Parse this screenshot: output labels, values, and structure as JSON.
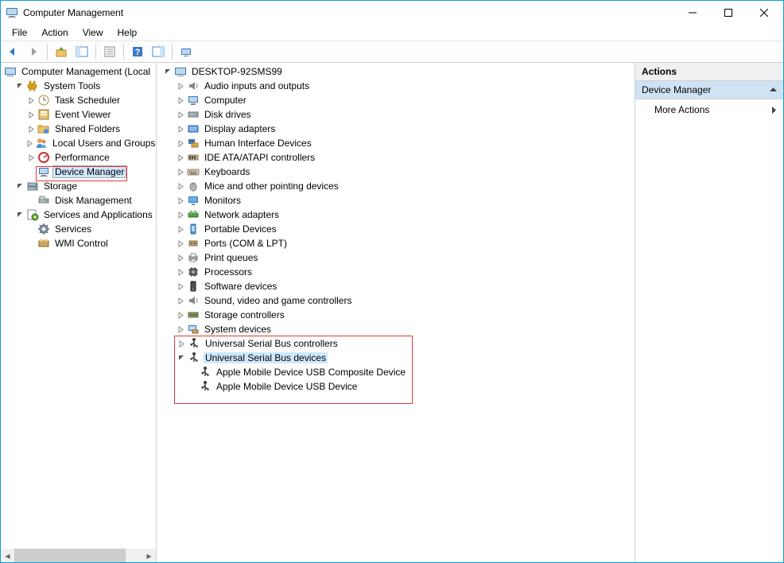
{
  "window": {
    "title": "Computer Management"
  },
  "menu": {
    "file": "File",
    "action": "Action",
    "view": "View",
    "help": "Help"
  },
  "leftTree": {
    "root": "Computer Management (Local",
    "systemTools": "System Tools",
    "taskScheduler": "Task Scheduler",
    "eventViewer": "Event Viewer",
    "sharedFolders": "Shared Folders",
    "localUsers": "Local Users and Groups",
    "performance": "Performance",
    "deviceManager": "Device Manager",
    "storage": "Storage",
    "diskManagement": "Disk Management",
    "servicesApps": "Services and Applications",
    "services": "Services",
    "wmiControl": "WMI Control"
  },
  "midTree": {
    "root": "DESKTOP-92SMS99",
    "audio": "Audio inputs and outputs",
    "computer": "Computer",
    "disk": "Disk drives",
    "display": "Display adapters",
    "hid": "Human Interface Devices",
    "ide": "IDE ATA/ATAPI controllers",
    "keyboards": "Keyboards",
    "mice": "Mice and other pointing devices",
    "monitors": "Monitors",
    "network": "Network adapters",
    "portable": "Portable Devices",
    "ports": "Ports (COM & LPT)",
    "printq": "Print queues",
    "processors": "Processors",
    "software": "Software devices",
    "sound": "Sound, video and game controllers",
    "storagectl": "Storage controllers",
    "sysdev": "System devices",
    "usbctl": "Universal Serial Bus controllers",
    "usbdev": "Universal Serial Bus devices",
    "apple1": "Apple Mobile Device USB Composite Device",
    "apple2": "Apple Mobile Device USB Device"
  },
  "actions": {
    "header": "Actions",
    "selected": "Device Manager",
    "more": "More Actions"
  }
}
